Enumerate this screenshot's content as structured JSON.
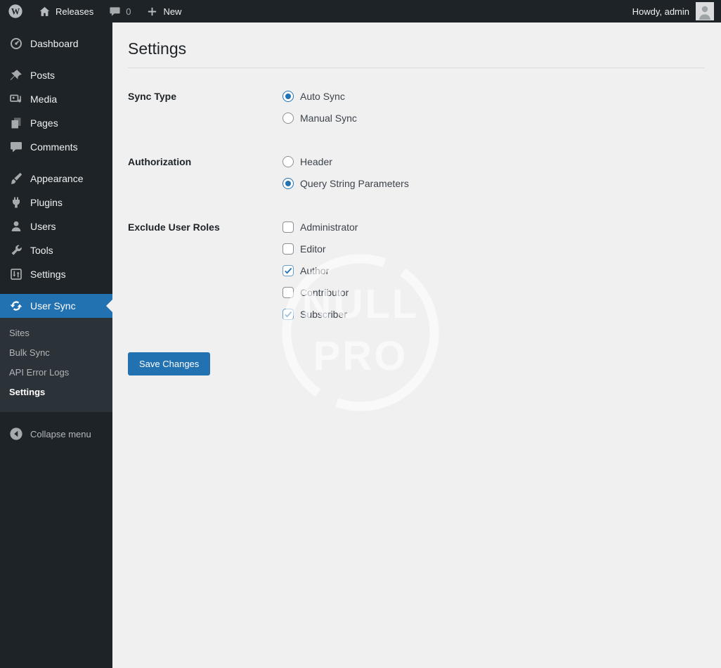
{
  "admin_bar": {
    "wordpress_logo_icon": "wordpress-logo",
    "home_icon": "home",
    "site_name": "Releases",
    "comments_icon": "comment-bubble",
    "comments_count": "0",
    "new_icon": "plus",
    "new_label": "New",
    "howdy_text": "Howdy, admin",
    "avatar_icon": "user-avatar"
  },
  "sidebar": {
    "items": [
      {
        "label": "Dashboard",
        "icon": "dashboard",
        "active": false,
        "separator_before": false
      },
      {
        "label": "Posts",
        "icon": "posts",
        "active": false,
        "separator_before": true
      },
      {
        "label": "Media",
        "icon": "media",
        "active": false,
        "separator_before": false
      },
      {
        "label": "Pages",
        "icon": "pages",
        "active": false,
        "separator_before": false
      },
      {
        "label": "Comments",
        "icon": "comments",
        "active": false,
        "separator_before": false
      },
      {
        "label": "Appearance",
        "icon": "appearance",
        "active": false,
        "separator_before": true
      },
      {
        "label": "Plugins",
        "icon": "plugins",
        "active": false,
        "separator_before": false
      },
      {
        "label": "Users",
        "icon": "users",
        "active": false,
        "separator_before": false
      },
      {
        "label": "Tools",
        "icon": "tools",
        "active": false,
        "separator_before": false
      },
      {
        "label": "Settings",
        "icon": "settings",
        "active": false,
        "separator_before": false
      },
      {
        "label": "User Sync",
        "icon": "sync",
        "active": true,
        "separator_before": true
      }
    ],
    "submenu": [
      "Sites",
      "Bulk Sync",
      "API Error Logs",
      "Settings"
    ],
    "submenu_current": "Settings",
    "collapse_label": "Collapse menu",
    "collapse_icon": "collapse-arrow"
  },
  "main": {
    "title": "Settings",
    "fields": [
      {
        "label": "Sync Type",
        "type": "radio",
        "options": [
          {
            "label": "Auto Sync",
            "checked": true
          },
          {
            "label": "Manual Sync",
            "checked": false
          }
        ]
      },
      {
        "label": "Authorization",
        "type": "radio",
        "options": [
          {
            "label": "Header",
            "checked": false
          },
          {
            "label": "Query String Parameters",
            "checked": true
          }
        ]
      },
      {
        "label": "Exclude User Roles",
        "type": "checkbox",
        "options": [
          {
            "label": "Administrator",
            "checked": false
          },
          {
            "label": "Editor",
            "checked": false
          },
          {
            "label": "Author",
            "checked": true
          },
          {
            "label": "Contributor",
            "checked": false
          },
          {
            "label": "Subscriber",
            "checked": true
          }
        ]
      }
    ],
    "save_button_label": "Save Changes"
  },
  "watermark": {
    "line1": "NULL",
    "line2": "PRO"
  },
  "colors": {
    "accent": "#2271b1",
    "admin_bar_bg": "#1d2327",
    "sidebar_bg": "#1d2327",
    "submenu_bg": "#2c3338",
    "content_bg": "#f0f0f1",
    "heading_text": "#1d2327",
    "check_color": "#2271b1"
  }
}
